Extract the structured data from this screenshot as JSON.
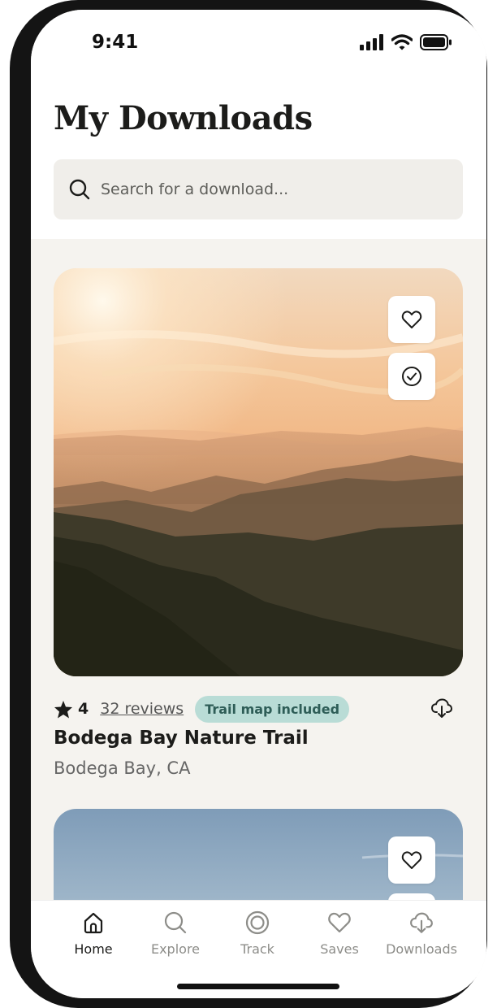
{
  "status_bar": {
    "time": "9:41"
  },
  "page": {
    "title": "My Downloads"
  },
  "search": {
    "placeholder": "Search for a download..."
  },
  "cards": [
    {
      "rating": "4",
      "reviews": "32 reviews",
      "tag": "Trail map included",
      "name": "Bodega Bay Nature Trail",
      "location": "Bodega Bay, CA",
      "image": "misty-sunset-mountain-ridges"
    },
    {
      "image": "blue-sky-landscape"
    }
  ],
  "tab_bar": {
    "active": "Home",
    "tabs": [
      {
        "label": "Home",
        "icon": "home-icon"
      },
      {
        "label": "Explore",
        "icon": "search-icon"
      },
      {
        "label": "Track",
        "icon": "target-icon"
      },
      {
        "label": "Saves",
        "icon": "heart-icon"
      },
      {
        "label": "Downloads",
        "icon": "cloud-download-icon"
      }
    ]
  },
  "colors": {
    "accent_tag_bg": "#b9dcd6",
    "accent_tag_text": "#2e5d57",
    "background": "#f5f3ef",
    "text": "#1c1c1a"
  }
}
